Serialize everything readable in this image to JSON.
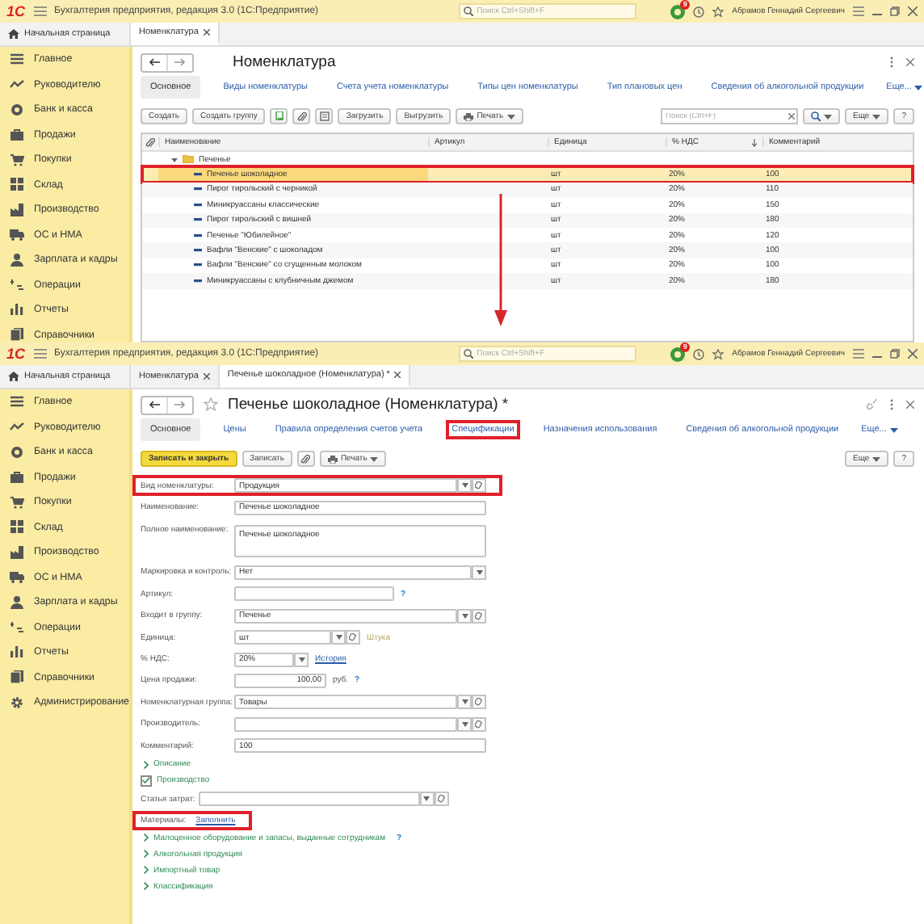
{
  "windows": [
    {
      "kind": "list",
      "title_bar": {
        "logo": "1С",
        "title": "Бухгалтерия предприятия, редакция 3.0 (1С:Предприятие)",
        "search_placeholder": "Поиск Ctrl+Shift+F",
        "notifications": "9",
        "user": "Абрамов Геннадий Сергеевич"
      },
      "open_tabs": [
        {
          "label": "Начальная страница",
          "kind": "home",
          "selected": false
        },
        {
          "label": "Номенклатура",
          "kind": "document",
          "selected": true
        }
      ],
      "sidebar": [
        "Главное",
        "Руководителю",
        "Банк и касса",
        "Продажи",
        "Покупки",
        "Склад",
        "Производство",
        "ОС и НМА",
        "Зарплата и кадры",
        "Операции",
        "Отчеты",
        "Справочники"
      ],
      "form": {
        "title": "Номенклатура",
        "links": [
          {
            "label": "Основное",
            "selected": true,
            "highlighted": false
          },
          {
            "label": "Виды номенклатуры",
            "selected": false,
            "highlighted": false
          },
          {
            "label": "Счета учета номенклатуры",
            "selected": false,
            "highlighted": false
          },
          {
            "label": "Типы цен номенклатуры",
            "selected": false,
            "highlighted": false
          },
          {
            "label": "Тип плановых цен",
            "selected": false,
            "highlighted": false
          },
          {
            "label": "Сведения об алкогольной продукции",
            "selected": false,
            "highlighted": false
          }
        ],
        "more_link": "Еще...",
        "toolbar": {
          "create": "Создать",
          "create_group": "Создать группу",
          "load": "Загрузить",
          "unload": "Выгрузить",
          "print": "Печать",
          "search_placeholder": "Поиск (Ctrl+F)",
          "more": "Еще",
          "help": "?"
        },
        "table": {
          "columns": [
            {
              "label": "Наименование",
              "sorted": false
            },
            {
              "label": "Артикул",
              "sorted": false
            },
            {
              "label": "Единица",
              "sorted": false
            },
            {
              "label": "% НДС",
              "sorted": true
            },
            {
              "label": "Комментарий",
              "sorted": false
            }
          ],
          "rows": [
            {
              "kind": "group",
              "name": "Печенье",
              "expanded": true,
              "children": [
                {
                  "kind": "item",
                  "name": "Печенье шоколадное",
                  "unit": "шт",
                  "vat": "20%",
                  "comment": "100",
                  "selected": true,
                  "highlighted": true
                },
                {
                  "kind": "item",
                  "name": "Пирог тирольский с черникой",
                  "unit": "шт",
                  "vat": "20%",
                  "comment": "110",
                  "selected": false,
                  "highlighted": false
                },
                {
                  "kind": "item",
                  "name": "Миникруассаны классические",
                  "unit": "шт",
                  "vat": "20%",
                  "comment": "150",
                  "selected": false,
                  "highlighted": false
                },
                {
                  "kind": "item",
                  "name": "Пирог тирольский с вишней",
                  "unit": "шт",
                  "vat": "20%",
                  "comment": "180",
                  "selected": false,
                  "highlighted": false
                },
                {
                  "kind": "item",
                  "name": "Печенье \"Юбилейное\"",
                  "unit": "шт",
                  "vat": "20%",
                  "comment": "120",
                  "selected": false,
                  "highlighted": false
                },
                {
                  "kind": "item",
                  "name": "Вафли \"Венские\" с шоколадом",
                  "unit": "шт",
                  "vat": "20%",
                  "comment": "100",
                  "selected": false,
                  "highlighted": false
                },
                {
                  "kind": "item",
                  "name": "Вафли \"Венские\" со сгущенным молоком",
                  "unit": "шт",
                  "vat": "20%",
                  "comment": "100",
                  "selected": false,
                  "highlighted": false
                },
                {
                  "kind": "item",
                  "name": "Миникруассаны с клубничным джемом",
                  "unit": "шт",
                  "vat": "20%",
                  "comment": "180",
                  "selected": false,
                  "highlighted": false
                }
              ]
            }
          ]
        }
      }
    },
    {
      "kind": "item",
      "title_bar": {
        "logo": "1С",
        "title": "Бухгалтерия предприятия, редакция 3.0 (1С:Предприятие)",
        "search_placeholder": "Поиск Ctrl+Shift+F",
        "notifications": "9",
        "user": "Абрамов Геннадий Сергеевич"
      },
      "open_tabs": [
        {
          "label": "Начальная страница",
          "kind": "home",
          "selected": false
        },
        {
          "label": "Номенклатура",
          "kind": "document",
          "selected": false
        },
        {
          "label": "Печенье шоколадное (Номенклатура) *",
          "kind": "document",
          "selected": true
        }
      ],
      "sidebar": [
        "Главное",
        "Руководителю",
        "Банк и касса",
        "Продажи",
        "Покупки",
        "Склад",
        "Производство",
        "ОС и НМА",
        "Зарплата и кадры",
        "Операции",
        "Отчеты",
        "Справочники",
        "Администрирование"
      ],
      "form": {
        "title": "Печенье шоколадное (Номенклатура) *",
        "links": [
          {
            "label": "Основное",
            "selected": true,
            "highlighted": false
          },
          {
            "label": "Цены",
            "selected": false,
            "highlighted": false
          },
          {
            "label": "Правила определения счетов учета",
            "selected": false,
            "highlighted": false
          },
          {
            "label": "Спецификации",
            "selected": false,
            "highlighted": true
          },
          {
            "label": "Назначения использования",
            "selected": false,
            "highlighted": false
          },
          {
            "label": "Сведения об алкогольной продукции",
            "selected": false,
            "highlighted": false
          }
        ],
        "more_link": "Еще...",
        "toolbar": {
          "save_close": "Записать и закрыть",
          "save": "Записать",
          "print": "Печать",
          "more": "Еще",
          "help": "?"
        },
        "fields": [
          {
            "kind": "select",
            "label": "Вид номенклатуры:",
            "value": "Продукция",
            "highlighted": true
          },
          {
            "kind": "text",
            "label": "Наименование:",
            "value": "Печенье шоколадное",
            "highlighted": false
          },
          {
            "kind": "textarea",
            "label": "Полное наименование:",
            "value": "Печенье шоколадное",
            "highlighted": false
          },
          {
            "kind": "dropdown",
            "label": "Маркировка и контроль:",
            "value": "Нет",
            "highlighted": false
          },
          {
            "kind": "short_text",
            "label": "Артикул:",
            "help": "?",
            "highlighted": false
          },
          {
            "kind": "select",
            "label": "Входит в группу:",
            "value": "Печенье",
            "highlighted": false
          },
          {
            "kind": "short_select",
            "label": "Единица:",
            "value": "шт",
            "note": "Штука",
            "highlighted": false
          },
          {
            "kind": "short_dropdown",
            "label": "% НДС:",
            "value": "20%",
            "link": "История",
            "highlighted": false
          },
          {
            "kind": "amount",
            "label": "Цена продажи:",
            "value": "100,00",
            "note": "руб.",
            "help": "?",
            "highlighted": false
          },
          {
            "kind": "select",
            "label": "Номенклатурная группа:",
            "value": "Товары",
            "highlighted": false
          },
          {
            "kind": "select",
            "label": "Производитель:",
            "highlighted": false
          },
          {
            "kind": "text",
            "label": "Комментарий:",
            "value": "100",
            "highlighted": false
          },
          {
            "kind": "group",
            "label": "Описание",
            "expanded": false,
            "highlighted": false
          },
          {
            "kind": "checkbox",
            "label": "Производство",
            "checked": true,
            "highlighted": false
          },
          {
            "kind": "inline_select",
            "label": "Статья затрат:",
            "highlighted": false
          },
          {
            "kind": "fill",
            "label": "Материалы:",
            "link": "Заполнить",
            "highlighted": true
          },
          {
            "kind": "group",
            "label": "Малоценное оборудование и запасы, выданные сотрудникам",
            "help": "?",
            "expanded": false,
            "highlighted": false
          },
          {
            "kind": "group",
            "label": "Алкогольная продукция",
            "expanded": false,
            "highlighted": false
          },
          {
            "kind": "group",
            "label": "Импортный товар",
            "expanded": false,
            "highlighted": false
          },
          {
            "kind": "group",
            "label": "Классификация",
            "expanded": false,
            "highlighted": false
          }
        ]
      }
    }
  ]
}
